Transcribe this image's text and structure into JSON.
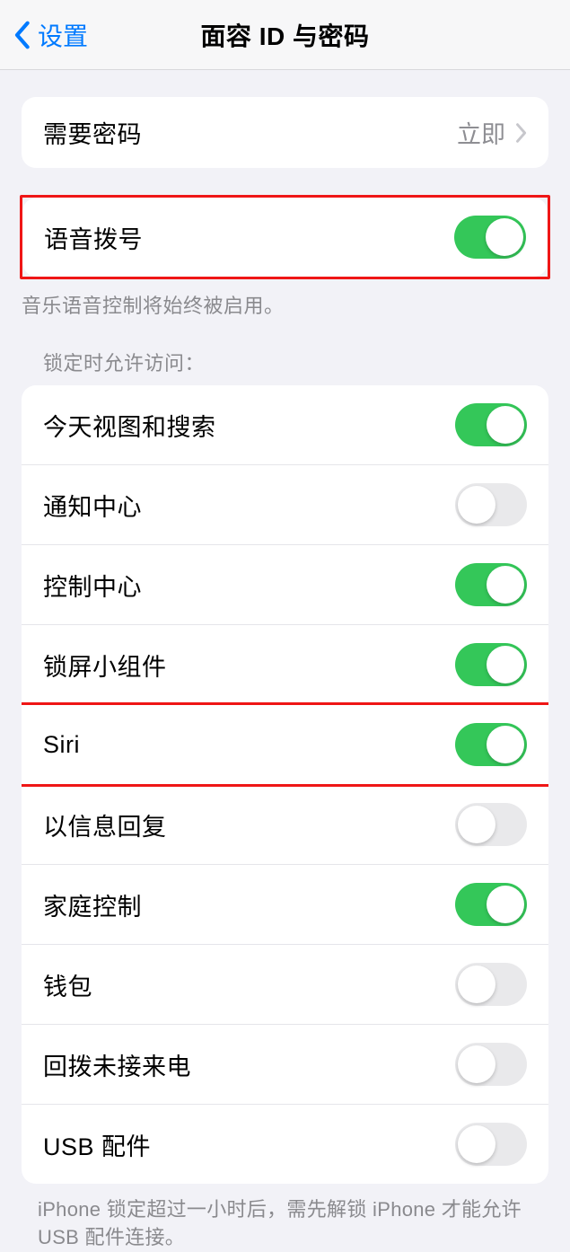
{
  "nav": {
    "back_label": "设置",
    "title": "面容 ID 与密码"
  },
  "require_passcode": {
    "label": "需要密码",
    "value": "立即"
  },
  "voice_dial": {
    "label": "语音拨号",
    "on": true,
    "footer": "音乐语音控制将始终被启用。"
  },
  "lock_access": {
    "header": "锁定时允许访问：",
    "items": [
      {
        "label": "今天视图和搜索",
        "on": true,
        "highlight": false
      },
      {
        "label": "通知中心",
        "on": false,
        "highlight": false
      },
      {
        "label": "控制中心",
        "on": true,
        "highlight": false
      },
      {
        "label": "锁屏小组件",
        "on": true,
        "highlight": false
      },
      {
        "label": "Siri",
        "on": true,
        "highlight": true
      },
      {
        "label": "以信息回复",
        "on": false,
        "highlight": false
      },
      {
        "label": "家庭控制",
        "on": true,
        "highlight": false
      },
      {
        "label": "钱包",
        "on": false,
        "highlight": false
      },
      {
        "label": "回拨未接来电",
        "on": false,
        "highlight": false
      },
      {
        "label": "USB 配件",
        "on": false,
        "highlight": false
      }
    ]
  },
  "usb_footer": "iPhone 锁定超过一小时后，需先解锁 iPhone 才能允许USB 配件连接。"
}
